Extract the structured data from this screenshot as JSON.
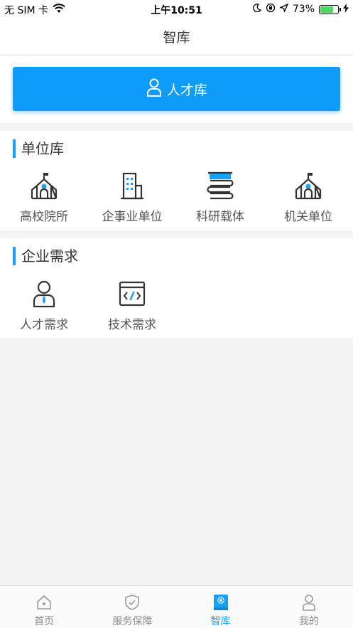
{
  "status_bar": {
    "carrier": "无 SIM 卡",
    "time": "上午10:51",
    "battery": "73%",
    "battery_level": 0.73,
    "icons": [
      "wifi-icon",
      "moon-icon",
      "rotation-lock-icon",
      "location-icon",
      "battery-icon",
      "charging-icon"
    ]
  },
  "nav": {
    "title": "智库"
  },
  "talent_button": {
    "label": "人才库",
    "icon": "person-icon",
    "color": "#0f9bf8"
  },
  "sections": {
    "units": {
      "title": "单位库",
      "items": [
        {
          "label": "高校院所",
          "icon": "school-building-icon"
        },
        {
          "label": "企事业单位",
          "icon": "office-building-icon"
        },
        {
          "label": "科研载体",
          "icon": "book-stack-icon"
        },
        {
          "label": "机关单位",
          "icon": "government-building-icon"
        }
      ]
    },
    "demand": {
      "title": "企业需求",
      "items": [
        {
          "label": "人才需求",
          "icon": "talent-person-icon"
        },
        {
          "label": "技术需求",
          "icon": "code-window-icon"
        }
      ]
    }
  },
  "tab_bar": {
    "tabs": [
      {
        "label": "首页",
        "icon": "home-icon",
        "active": false
      },
      {
        "label": "服务保障",
        "icon": "shield-check-icon",
        "active": false
      },
      {
        "label": "智库",
        "icon": "think-tank-icon",
        "active": true
      },
      {
        "label": "我的",
        "icon": "profile-icon",
        "active": false
      }
    ]
  },
  "colors": {
    "accent": "#1aa1f7",
    "button": "#0f9bf8",
    "background": "#f4f4f4"
  }
}
